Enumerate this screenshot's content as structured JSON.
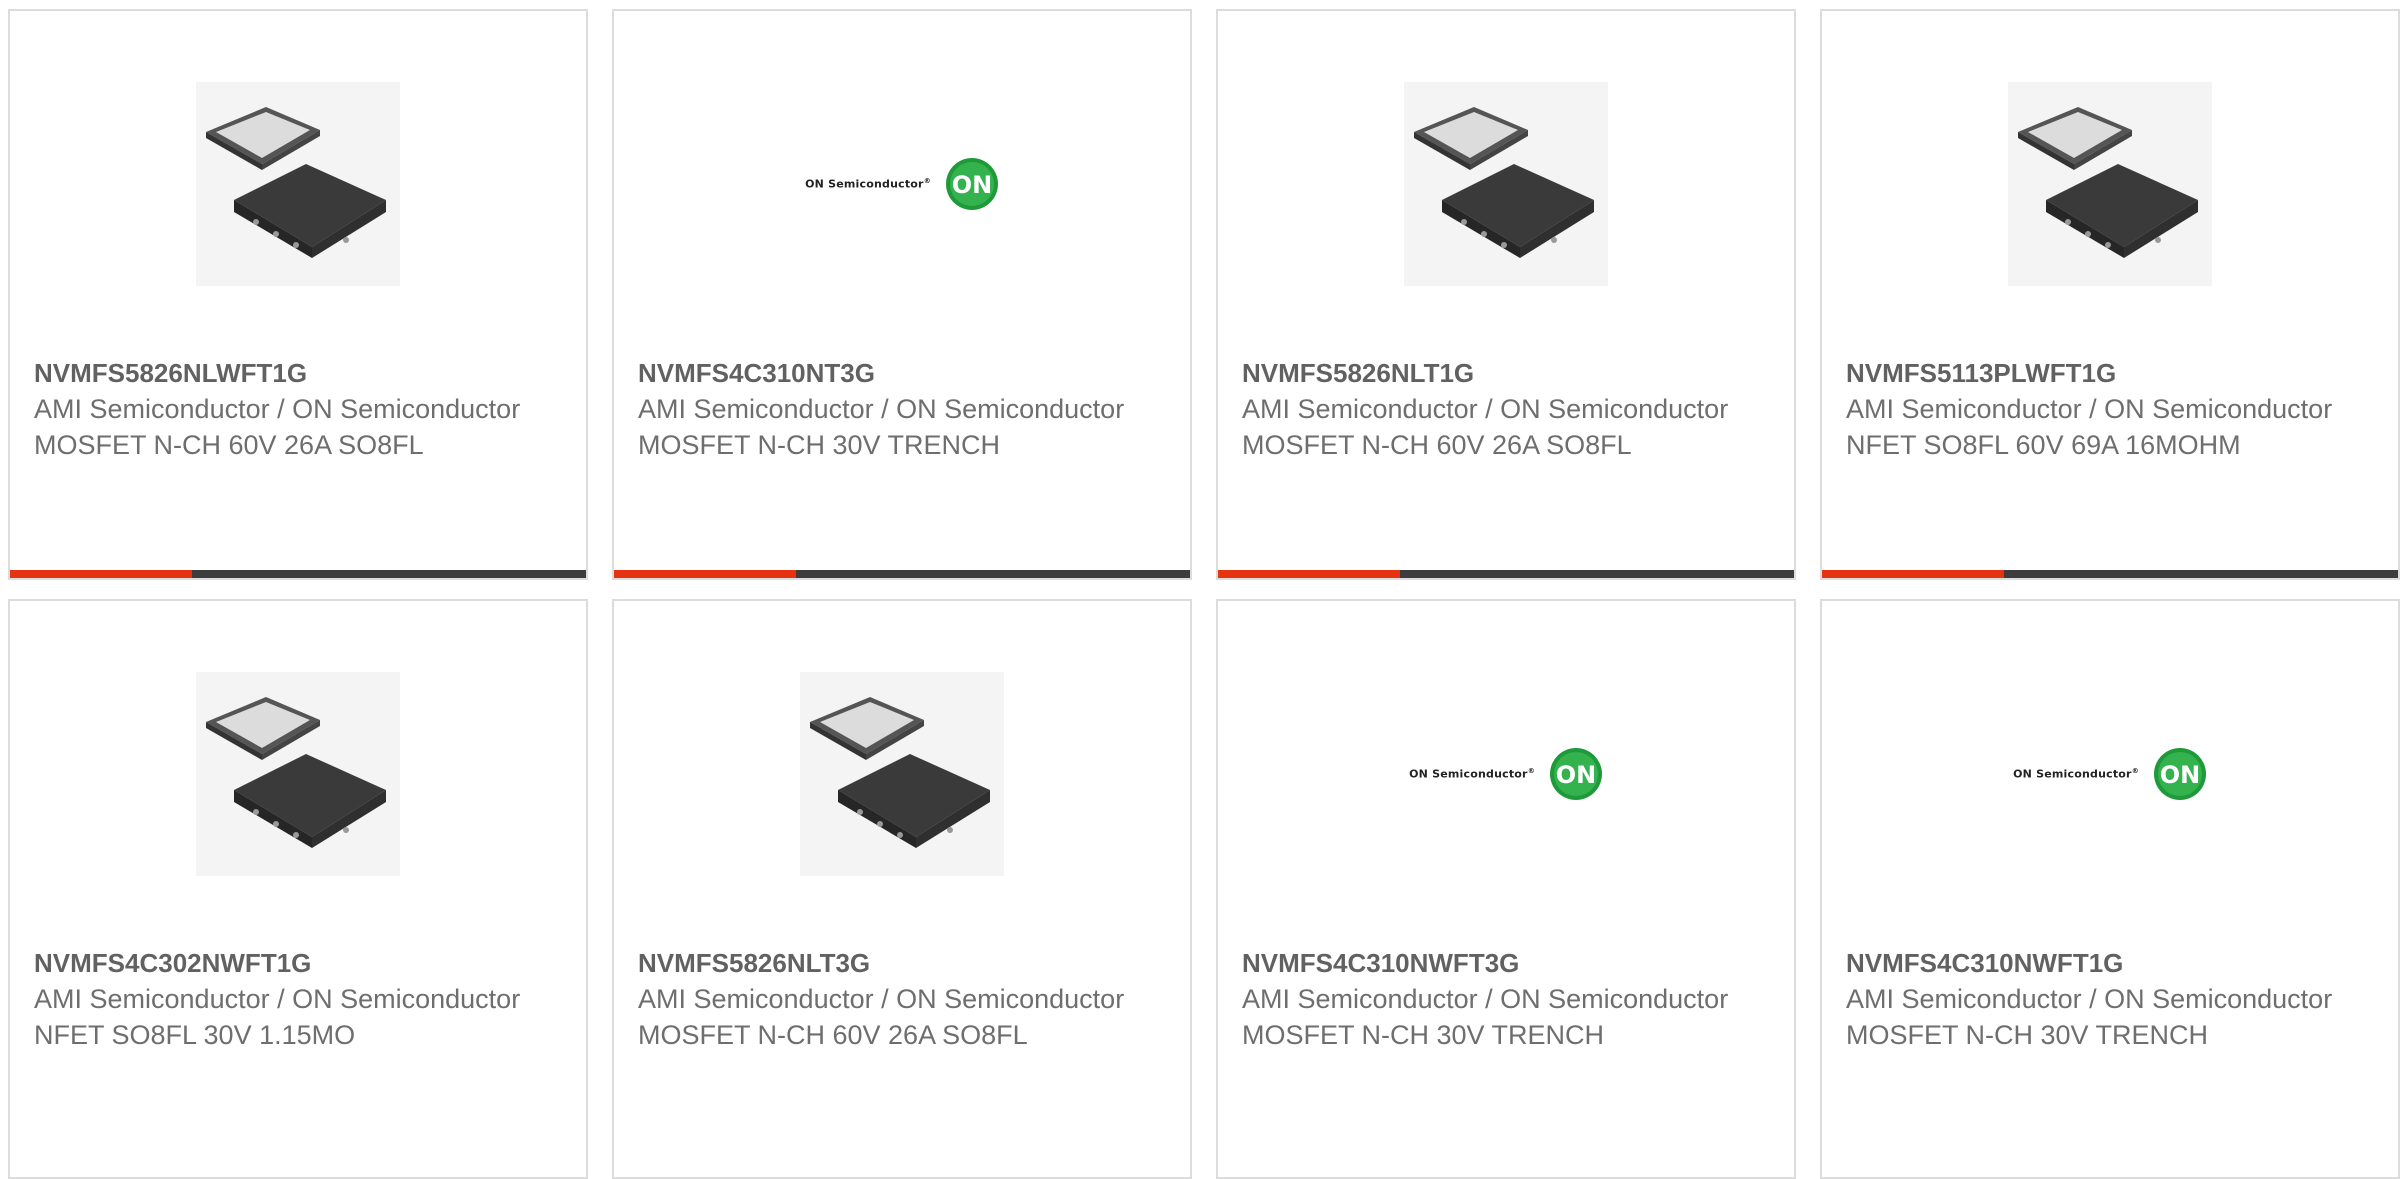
{
  "theme": {
    "accent": "#e63312",
    "bar": "#3d3d3d",
    "border": "#dcdcdc",
    "logo_green": "#1f9a3a"
  },
  "brand": {
    "logo_text": "ON Semiconductor",
    "logo_mark": "ON"
  },
  "products": [
    {
      "part": "NVMFS5826NLWFT1G",
      "manufacturer": "AMI Semiconductor / ON Semiconductor",
      "description": "MOSFET N-CH 60V 26A SO8FL",
      "image": "mosfet-package-icon"
    },
    {
      "part": "NVMFS4C310NT3G",
      "manufacturer": "AMI Semiconductor / ON Semiconductor",
      "description": "MOSFET N-CH 30V TRENCH",
      "image": "on-semiconductor-logo"
    },
    {
      "part": "NVMFS5826NLT1G",
      "manufacturer": "AMI Semiconductor / ON Semiconductor",
      "description": "MOSFET N-CH 60V 26A SO8FL",
      "image": "mosfet-package-icon"
    },
    {
      "part": "NVMFS5113PLWFT1G",
      "manufacturer": "AMI Semiconductor / ON Semiconductor",
      "description": "NFET SO8FL 60V 69A 16MOHM",
      "image": "mosfet-package-icon"
    },
    {
      "part": "NVMFS4C302NWFT1G",
      "manufacturer": "AMI Semiconductor / ON Semiconductor",
      "description": "NFET SO8FL 30V 1.15MO",
      "image": "mosfet-package-icon"
    },
    {
      "part": "NVMFS5826NLT3G",
      "manufacturer": "AMI Semiconductor / ON Semiconductor",
      "description": "MOSFET N-CH 60V 26A SO8FL",
      "image": "mosfet-package-icon"
    },
    {
      "part": "NVMFS4C310NWFT3G",
      "manufacturer": "AMI Semiconductor / ON Semiconductor",
      "description": "MOSFET N-CH 30V TRENCH",
      "image": "on-semiconductor-logo"
    },
    {
      "part": "NVMFS4C310NWFT1G",
      "manufacturer": "AMI Semiconductor / ON Semiconductor",
      "description": "MOSFET N-CH 30V TRENCH",
      "image": "on-semiconductor-logo"
    }
  ]
}
